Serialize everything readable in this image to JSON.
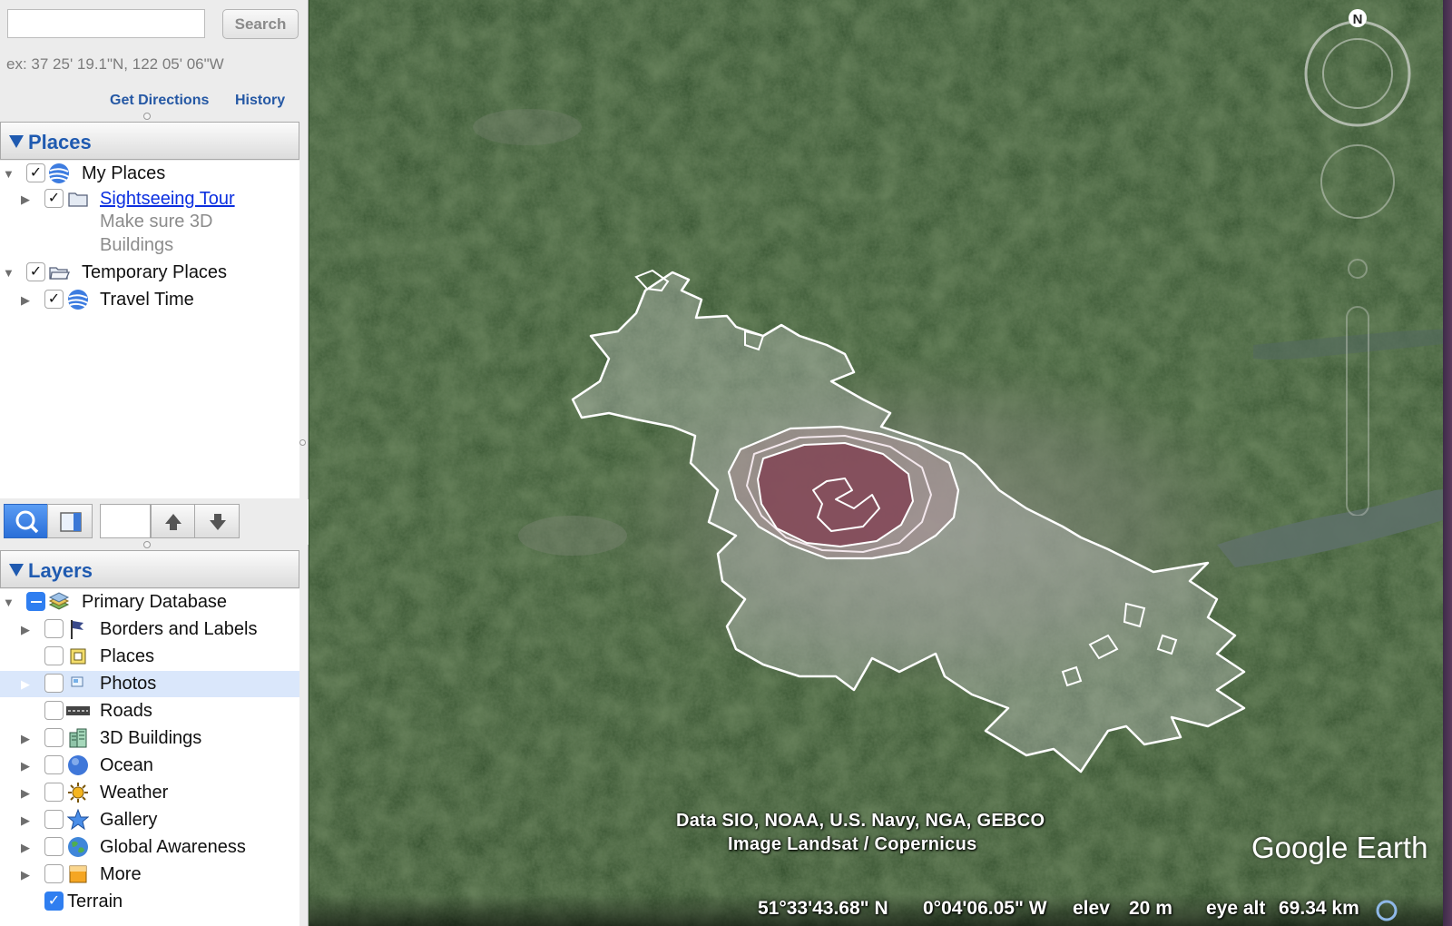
{
  "search": {
    "placeholder": "",
    "button_label": "Search",
    "hint": "ex: 37 25' 19.1\"N, 122 05' 06\"W",
    "get_directions": "Get Directions",
    "history": "History"
  },
  "places": {
    "header": "Places",
    "my_places": "My Places",
    "sightseeing_tour": "Sightseeing Tour",
    "sightseeing_desc_1": "Make sure 3D",
    "sightseeing_desc_2": "Buildings",
    "temporary_places": "Temporary Places",
    "travel_time": "Travel Time"
  },
  "layers": {
    "header": "Layers",
    "items": [
      {
        "label": "Primary Database"
      },
      {
        "label": "Borders and Labels"
      },
      {
        "label": "Places"
      },
      {
        "label": "Photos"
      },
      {
        "label": "Roads"
      },
      {
        "label": "3D Buildings"
      },
      {
        "label": "Ocean"
      },
      {
        "label": "Weather"
      },
      {
        "label": "Gallery"
      },
      {
        "label": "Global Awareness"
      },
      {
        "label": "More"
      },
      {
        "label": "Terrain"
      }
    ]
  },
  "map": {
    "attribution_line_1": "Data SIO, NOAA, U.S. Navy, NGA, GEBCO",
    "attribution_line_2": "Image Landsat / Copernicus",
    "logo": "Google Earth",
    "compass_label": "N",
    "status": {
      "lat": "51°33'43.68\" N",
      "lon": "0°04'06.05\" W",
      "elev_label": "elev",
      "elev_value": "20 m",
      "eye_alt_label": "eye alt",
      "eye_alt_value": "69.34 km"
    }
  },
  "colors": {
    "accent": "#1f5ab0",
    "link": "#2558a4",
    "selection": "#dae7fb"
  }
}
